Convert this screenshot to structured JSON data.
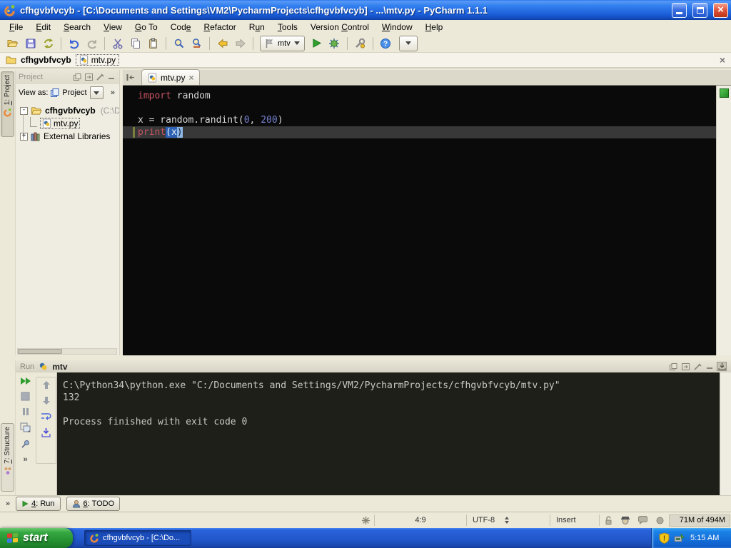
{
  "glyphs": {
    "collapse": "-",
    "expand": "+",
    "close": "×",
    "chevrons": "»",
    "tab_close": "×"
  },
  "colors": {
    "titlebar_blue": "#1b5ed8",
    "keyword": "#c75462",
    "number": "#7581cf",
    "editor_bg": "#0a0a0a",
    "console_bg": "#1d1f18",
    "run_green": "#2f9e2f",
    "taskbar_blue": "#2258cc",
    "start_green": "#259031"
  },
  "title_bar": {
    "title": "cfhgvbfvcyb - [C:\\Documents and Settings\\VM2\\PycharmProjects\\cfhgvbfvcyb] - ...\\mtv.py - PyCharm 1.1.1"
  },
  "menu_bar": {
    "items": [
      {
        "pre": "",
        "mn": "F",
        "post": "ile"
      },
      {
        "pre": "",
        "mn": "E",
        "post": "dit"
      },
      {
        "pre": "",
        "mn": "S",
        "post": "earch"
      },
      {
        "pre": "",
        "mn": "V",
        "post": "iew"
      },
      {
        "pre": "",
        "mn": "G",
        "post": "o To"
      },
      {
        "pre": "Cod",
        "mn": "e",
        "post": ""
      },
      {
        "pre": "",
        "mn": "R",
        "post": "efactor"
      },
      {
        "pre": "R",
        "mn": "u",
        "post": "n"
      },
      {
        "pre": "",
        "mn": "T",
        "post": "ools"
      },
      {
        "pre": "Version ",
        "mn": "C",
        "post": "ontrol"
      },
      {
        "pre": "",
        "mn": "W",
        "post": "indow"
      },
      {
        "pre": "",
        "mn": "H",
        "post": "elp"
      }
    ]
  },
  "toolbar": {
    "run_config_label": "mtv"
  },
  "breadcrumb": {
    "project_label": "cfhgvbfvcyb",
    "file_label": "mtv.py"
  },
  "left_stripe": {
    "project_btn": {
      "mn": "1",
      "post": ": Project"
    },
    "structure_btn": {
      "mn": "7",
      "post": ": Structure"
    }
  },
  "project_panel": {
    "header_title": "Project",
    "view_as_label": "View as:",
    "view_mode": "Project",
    "chevrons": "»",
    "tree": {
      "root_label": "cfhgvbfvcyb",
      "root_path": "(C:\\Do",
      "file_label": "mtv.py",
      "libraries_label": "External Libraries"
    }
  },
  "editor": {
    "tab_label": "mtv.py",
    "code": {
      "l1_kw": "import",
      "l1_rest": " random",
      "l3_pre": "x ",
      "l3_eq": "=",
      "l3_mid": " random.randint(",
      "l3_num1": "0",
      "l3_sep": ", ",
      "l3_num2": "200",
      "l3_close": ")",
      "l4_kw": "print",
      "l4_sel": "(x",
      "l4_caret": ")"
    }
  },
  "run_panel": {
    "title": "Run",
    "tab_label": "mtv",
    "console_lines": [
      "C:\\Python34\\python.exe \"C:/Documents and Settings/VM2/PycharmProjects/cfhgvbfvcyb/mtv.py\"",
      "132",
      "",
      "Process finished with exit code 0"
    ]
  },
  "tool_buttons_bar": {
    "chevrons": "»",
    "run_button": {
      "mn": "4",
      "post": ": Run"
    },
    "todo_button": {
      "mn": "6",
      "post": ": TODO"
    }
  },
  "status_bar": {
    "caret_position": "4:9",
    "encoding": "UTF-8",
    "input_mode": "Insert",
    "memory": "71M of 494M"
  },
  "taskbar": {
    "start_label": "start",
    "task_label": "cfhgvbfvcyb - [C:\\Do...",
    "time": "5:15 AM"
  }
}
